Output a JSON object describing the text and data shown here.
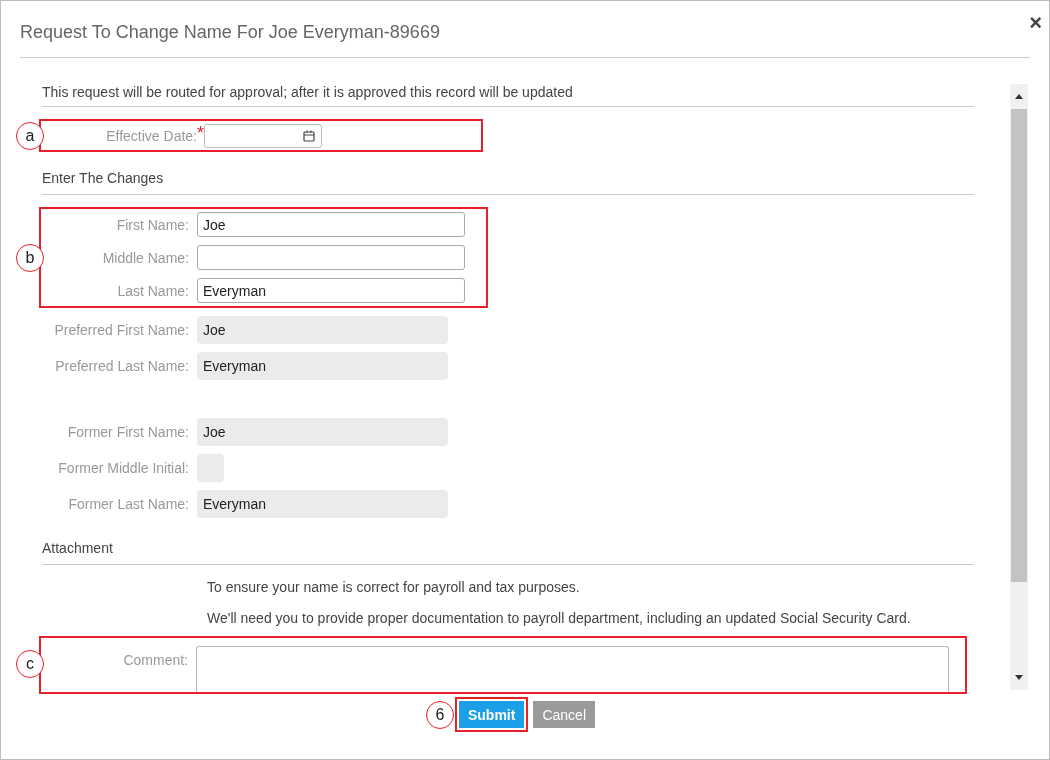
{
  "dialog": {
    "title": "Request To Change Name For Joe Everyman-89669",
    "close": "×"
  },
  "intro": "This request will be routed for approval; after it is approved this record will be updated",
  "effective_date": {
    "marker": "a",
    "label": "Effective Date:",
    "required": true,
    "required_mark": "*"
  },
  "changes": {
    "heading": "Enter The Changes",
    "marker": "b",
    "fields": [
      {
        "label": "First Name:",
        "value": "Joe"
      },
      {
        "label": "Middle Name:"
      },
      {
        "label": "Last Name:",
        "value": "Everyman"
      }
    ]
  },
  "preferred": [
    {
      "label": "Preferred First Name:",
      "value": "Joe"
    },
    {
      "label": "Preferred Last Name:",
      "value": "Everyman"
    }
  ],
  "former": [
    {
      "label": "Former First Name:",
      "value": "Joe",
      "kind": "wide"
    },
    {
      "label": "Former Middle Initial:",
      "kind": "short"
    },
    {
      "label": "Former Last Name:",
      "value": "Everyman",
      "kind": "wide"
    }
  ],
  "attachment": {
    "heading": "Attachment",
    "notes": [
      "To ensure your name is correct for payroll and tax purposes.",
      "We'll need you to provide proper documentation to payroll department, including an updated Social Security Card."
    ]
  },
  "comment": {
    "marker": "c",
    "label": "Comment:"
  },
  "buttons": [
    {
      "label": "Submit",
      "kind": "primary",
      "marker": "6"
    },
    {
      "label": "Cancel",
      "kind": "secondary"
    }
  ]
}
